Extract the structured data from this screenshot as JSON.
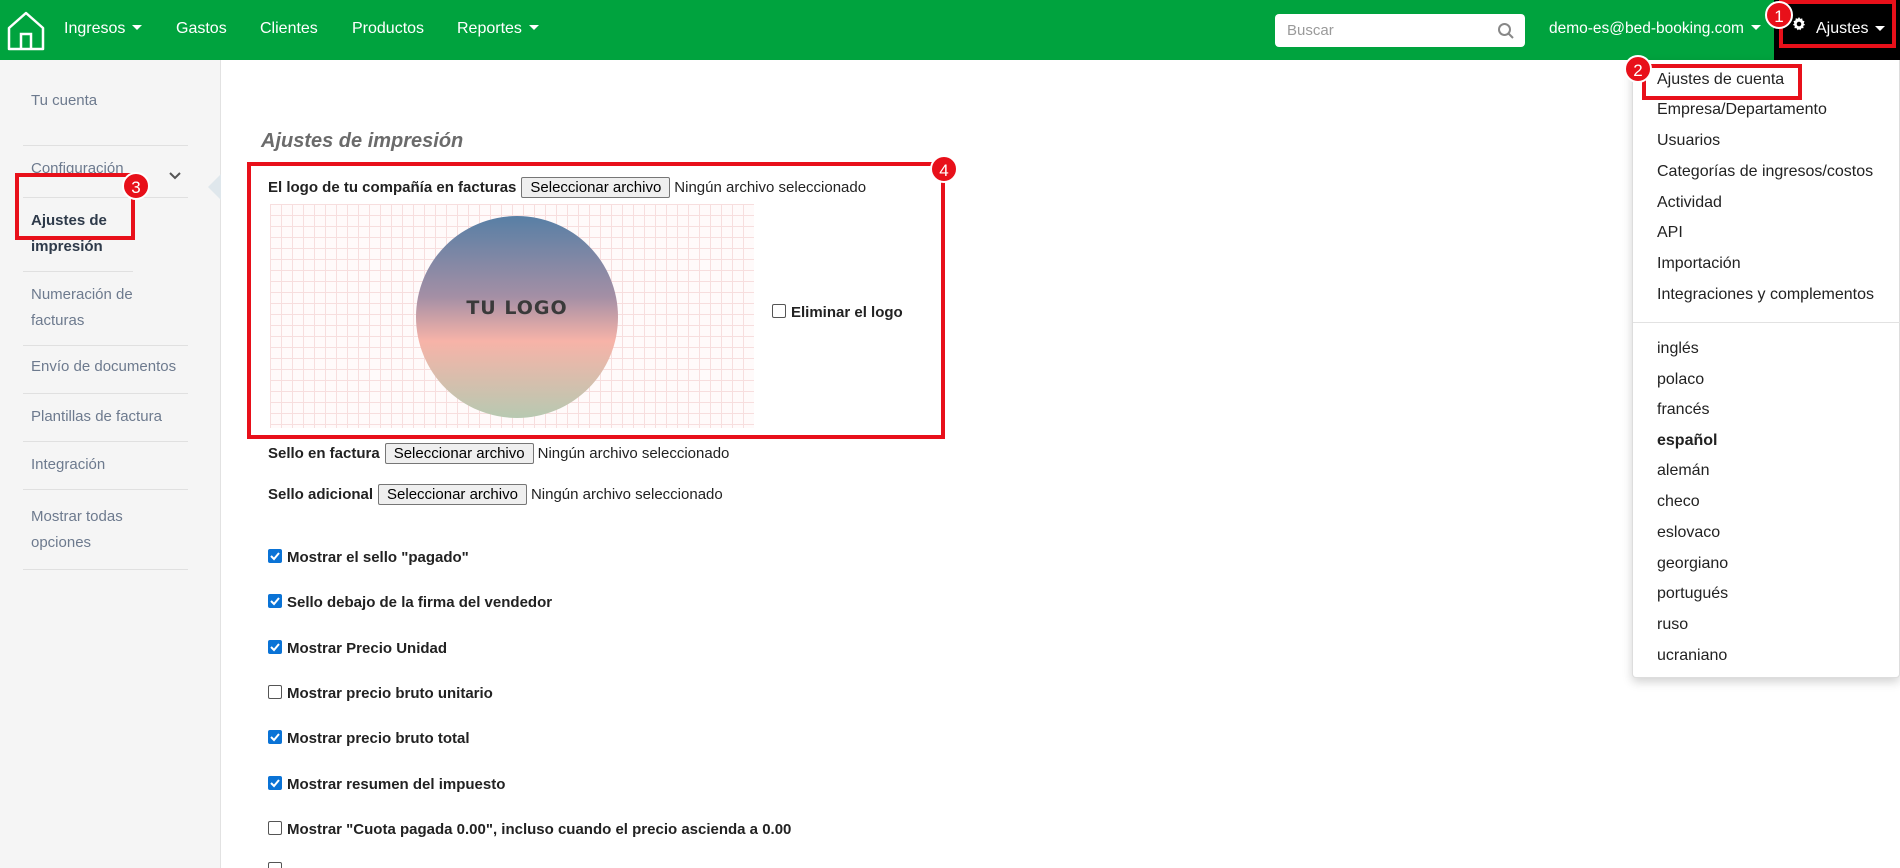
{
  "navbar": {
    "menu": [
      {
        "label": "Ingresos",
        "caret": true
      },
      {
        "label": "Gastos",
        "caret": false
      },
      {
        "label": "Clientes",
        "caret": false
      },
      {
        "label": "Productos",
        "caret": false
      },
      {
        "label": "Reportes",
        "caret": true
      }
    ],
    "search_placeholder": "Buscar",
    "account": "demo-es@bed-booking.com",
    "settings_label": "Ajustes"
  },
  "sidebar": {
    "items": [
      {
        "label": "Tu cuenta"
      },
      {
        "label": "Configuración"
      },
      {
        "label": "Ajustes de impresión"
      },
      {
        "label": "Numeración de facturas"
      },
      {
        "label": "Envío de documentos"
      },
      {
        "label": "Plantillas de factura"
      },
      {
        "label": "Integración"
      },
      {
        "label": "Mostrar todas opciones"
      }
    ]
  },
  "main": {
    "title": "Ajustes de impresión",
    "logo_label": "El logo de tu compañía en facturas",
    "choose_file": "Seleccionar archivo",
    "no_file": "Ningún archivo seleccionado",
    "logo_placeholder_text": "TU LOGO",
    "remove_logo": "Eliminar el logo",
    "stamp_label": "Sello en factura",
    "extra_stamp_label": "Sello adicional",
    "options": [
      {
        "label": "Mostrar el sello \"pagado\"",
        "checked": true
      },
      {
        "label": "Sello debajo de la firma del vendedor",
        "checked": true
      },
      {
        "label": "Mostrar Precio Unidad",
        "checked": true
      },
      {
        "label": "Mostrar precio bruto unitario",
        "checked": false
      },
      {
        "label": "Mostrar precio bruto total",
        "checked": true
      },
      {
        "label": "Mostrar resumen del impuesto",
        "checked": true
      },
      {
        "label": "Mostrar \"Cuota pagada 0.00\", incluso cuando el precio ascienda a 0.00",
        "checked": false
      }
    ]
  },
  "dropdown": {
    "settings_items": [
      "Ajustes de cuenta",
      "Empresa/Departamento",
      "Usuarios",
      "Categorías de ingresos/costos",
      "Actividad",
      "API",
      "Importación",
      "Integraciones y complementos"
    ],
    "languages": [
      "inglés",
      "polaco",
      "francés",
      "español",
      "alemán",
      "checo",
      "eslovaco",
      "georgiano",
      "portugués",
      "ruso",
      "ucraniano"
    ],
    "current_language": "español"
  },
  "annotations": [
    "1",
    "2",
    "3",
    "4"
  ],
  "colors": {
    "navbar": "#00a33e",
    "highlight": "#e8101a",
    "checkbox": "#0a73d6"
  }
}
